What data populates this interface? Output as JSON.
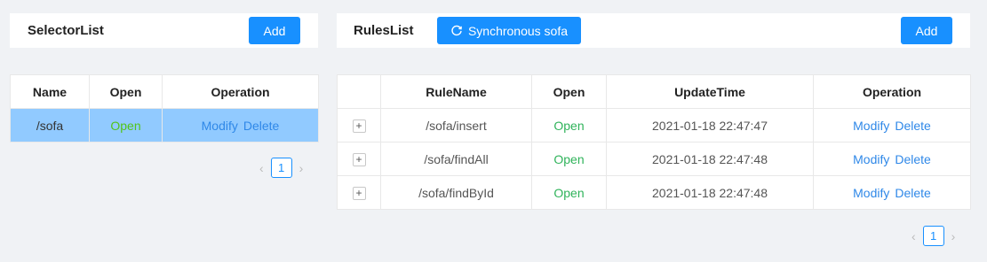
{
  "selector": {
    "title": "SelectorList",
    "add_label": "Add",
    "columns": [
      "Name",
      "Open",
      "Operation"
    ],
    "rows": [
      {
        "name": "/sofa",
        "open": "Open",
        "modify": "Modify",
        "delete": "Delete",
        "selected": true
      }
    ],
    "pagination": {
      "current": "1"
    }
  },
  "rules": {
    "title": "RulesList",
    "sync_label": "Synchronous sofa",
    "add_label": "Add",
    "columns": [
      "",
      "RuleName",
      "Open",
      "UpdateTime",
      "Operation"
    ],
    "rows": [
      {
        "expand": "+",
        "name": "/sofa/insert",
        "open": "Open",
        "time": "2021-01-18 22:47:47",
        "modify": "Modify",
        "delete": "Delete"
      },
      {
        "expand": "+",
        "name": "/sofa/findAll",
        "open": "Open",
        "time": "2021-01-18 22:47:48",
        "modify": "Modify",
        "delete": "Delete"
      },
      {
        "expand": "+",
        "name": "/sofa/findById",
        "open": "Open",
        "time": "2021-01-18 22:47:48",
        "modify": "Modify",
        "delete": "Delete"
      }
    ],
    "pagination": {
      "current": "1"
    }
  },
  "icons": {
    "sync": "sync-icon",
    "prev": "chevron-left-icon",
    "next": "chevron-right-icon"
  },
  "colors": {
    "primary": "#1890ff",
    "open": "#2fb35a",
    "link": "#2f88e8",
    "selected_row": "#91caff"
  }
}
